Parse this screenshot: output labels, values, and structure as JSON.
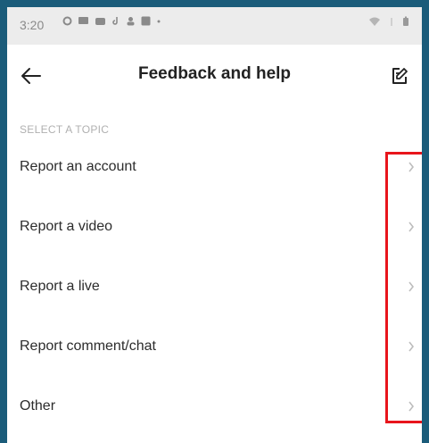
{
  "status_bar": {
    "time": "3:20"
  },
  "header": {
    "title": "Feedback and help"
  },
  "section": {
    "label": "SELECT A TOPIC"
  },
  "topics": [
    {
      "label": "Report an account"
    },
    {
      "label": "Report a video"
    },
    {
      "label": "Report a live"
    },
    {
      "label": "Report comment/chat"
    },
    {
      "label": "Other"
    }
  ],
  "icons": {
    "back": "arrow-left-icon",
    "edit": "edit-note-icon",
    "row_chevron": "chevron-right-icon"
  },
  "colors": {
    "background": "#1b5c7a",
    "highlight": "#e8151c",
    "chevron": "#bdbdbd"
  }
}
